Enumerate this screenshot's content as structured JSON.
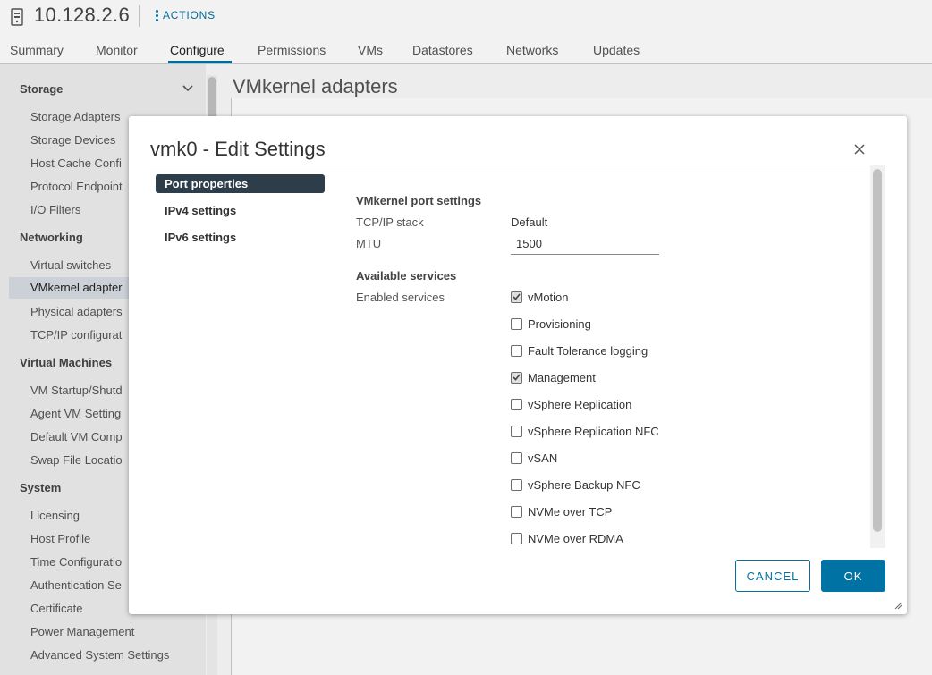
{
  "header": {
    "host_title": "10.128.2.6",
    "actions_label": "ACTIONS",
    "tabs": [
      {
        "label": "Summary"
      },
      {
        "label": "Monitor"
      },
      {
        "label": "Configure"
      },
      {
        "label": "Permissions"
      },
      {
        "label": "VMs"
      },
      {
        "label": "Datastores"
      },
      {
        "label": "Networks"
      },
      {
        "label": "Updates"
      }
    ],
    "active_tab": "Configure"
  },
  "sidebar": {
    "sections": [
      {
        "title": "Storage",
        "items": [
          "Storage Adapters",
          "Storage Devices",
          "Host Cache Confi",
          "Protocol Endpoint",
          "I/O Filters"
        ]
      },
      {
        "title": "Networking",
        "items": [
          "Virtual switches",
          "VMkernel adapter",
          "Physical adapters",
          "TCP/IP configurat"
        ]
      },
      {
        "title": "Virtual Machines",
        "items": [
          "VM Startup/Shutd",
          "Agent VM Setting",
          "Default VM Comp",
          "Swap File Locatio"
        ]
      },
      {
        "title": "System",
        "items": [
          "Licensing",
          "Host Profile",
          "Time Configuratio",
          "Authentication Se",
          "Certificate",
          "Power Management",
          "Advanced System Settings"
        ]
      }
    ],
    "active_item": "VMkernel adapter"
  },
  "main": {
    "title": "VMkernel adapters"
  },
  "modal": {
    "title": "vmk0 - Edit Settings",
    "nav": [
      "Port properties",
      "IPv4 settings",
      "IPv6 settings"
    ],
    "active_nav": "Port properties",
    "port_settings_heading": "VMkernel port settings",
    "tcpip_label": "TCP/IP stack",
    "tcpip_value": "Default",
    "mtu_label": "MTU",
    "mtu_value": "1500",
    "services_heading": "Available services",
    "enabled_services_label": "Enabled services",
    "services": [
      {
        "label": "vMotion",
        "checked": true
      },
      {
        "label": "Provisioning",
        "checked": false
      },
      {
        "label": "Fault Tolerance logging",
        "checked": false
      },
      {
        "label": "Management",
        "checked": true
      },
      {
        "label": "vSphere Replication",
        "checked": false
      },
      {
        "label": "vSphere Replication NFC",
        "checked": false
      },
      {
        "label": "vSAN",
        "checked": false
      },
      {
        "label": "vSphere Backup NFC",
        "checked": false
      },
      {
        "label": "NVMe over TCP",
        "checked": false
      },
      {
        "label": "NVMe over RDMA",
        "checked": false
      }
    ],
    "cancel_label": "CANCEL",
    "ok_label": "OK"
  },
  "colors": {
    "accent": "#0072a3",
    "nav_active_bg": "#2e3d4a",
    "sidebar_active_bg": "#d7dde4"
  }
}
